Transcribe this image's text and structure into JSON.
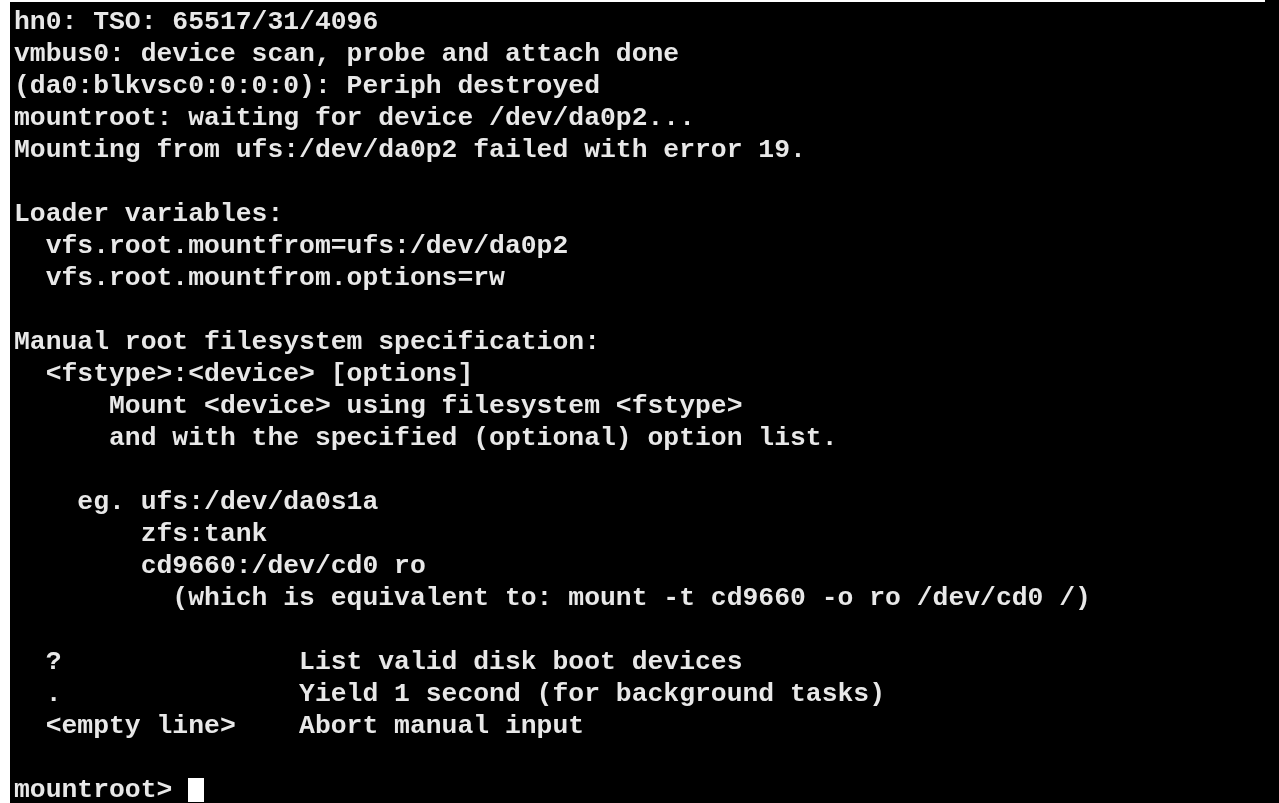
{
  "console": {
    "blocks": [
      [
        "hn0: TSO: 65517/31/4096",
        "vmbus0: device scan, probe and attach done",
        "(da0:blkvsc0:0:0:0): Periph destroyed",
        "mountroot: waiting for device /dev/da0p2...",
        "Mounting from ufs:/dev/da0p2 failed with error 19."
      ],
      [
        "Loader variables:",
        "  vfs.root.mountfrom=ufs:/dev/da0p2",
        "  vfs.root.mountfrom.options=rw"
      ],
      [
        "Manual root filesystem specification:",
        "  <fstype>:<device> [options]",
        "      Mount <device> using filesystem <fstype>",
        "      and with the specified (optional) option list."
      ],
      [
        "    eg. ufs:/dev/da0s1a",
        "        zfs:tank",
        "        cd9660:/dev/cd0 ro",
        "          (which is equivalent to: mount -t cd9660 -o ro /dev/cd0 /)"
      ],
      [
        "  ?               List valid disk boot devices",
        "  .               Yield 1 second (for background tasks)",
        "  <empty line>    Abort manual input"
      ]
    ],
    "prompt": {
      "text": "mountroot> ",
      "cursor_visible": true
    }
  }
}
